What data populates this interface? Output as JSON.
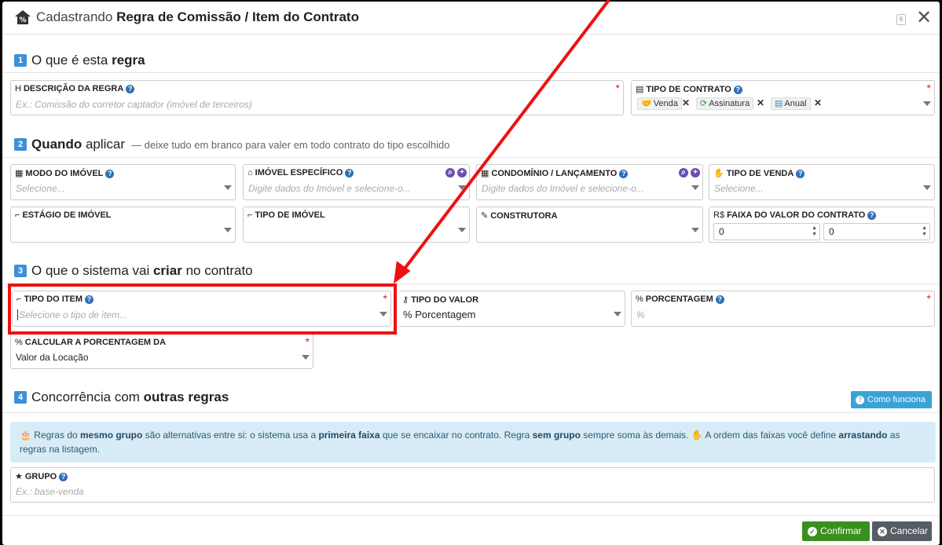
{
  "header": {
    "title_prefix": "Cadastrando",
    "title_bold": "Regra de Comissão / Item do Contrato",
    "shortcut_badge": "6",
    "close_glyph": "✕"
  },
  "sections": {
    "s1": {
      "num": "1",
      "text": "O que é esta ",
      "bold": "regra"
    },
    "s2": {
      "num": "2",
      "bold": "Quando",
      "text": " aplicar",
      "hint": "— deixe tudo em branco para valer em todo contrato do tipo escolhido"
    },
    "s3": {
      "num": "3",
      "text": "O que o sistema vai ",
      "bold": "criar",
      "text2": " no contrato"
    },
    "s4": {
      "num": "4",
      "text": "Concorrência com ",
      "bold": "outras regras"
    }
  },
  "fields": {
    "descricao": {
      "label": "DESCRIÇÃO DA REGRA",
      "icon": "H",
      "placeholder": "Ex.: Comissão do corretor captador (imóvel de terceiros)",
      "required": "*"
    },
    "tipo_contrato": {
      "label": "TIPO DE CONTRATO",
      "icon": "▤",
      "required": "*",
      "tags": [
        "Venda",
        "Assinatura",
        "Anual"
      ]
    },
    "modo_imovel": {
      "label": "MODO DO IMÓVEL",
      "icon": "▦",
      "placeholder": "Selecione..."
    },
    "imovel_especifico": {
      "label": "IMÓVEL ESPECÍFICO",
      "icon": "⌂",
      "placeholder": "Digite dados do Imóvel e selecione-o..."
    },
    "condominio": {
      "label": "CONDOMÍNIO / LANÇAMENTO",
      "icon": "▦",
      "placeholder": "Digite dados do Imóvel e selecione-o..."
    },
    "tipo_venda": {
      "label": "TIPO DE VENDA",
      "icon": "✋",
      "placeholder": "Selecione..."
    },
    "estagio": {
      "label": "ESTÁGIO DE IMÓVEL",
      "icon": "⌐"
    },
    "tipo_imovel": {
      "label": "TIPO DE IMÓVEL",
      "icon": "⌐"
    },
    "construtora": {
      "label": "CONSTRUTORA",
      "icon": "✎"
    },
    "faixa_valor": {
      "label": "FAIXA DO VALOR DO CONTRATO",
      "icon": "R$",
      "min": "0",
      "max": "0"
    },
    "tipo_item": {
      "label": "TIPO DO ITEM",
      "icon": "⌐",
      "placeholder": "Selecione o tipo de item...",
      "required": "*"
    },
    "tipo_valor": {
      "label": "TIPO DO VALOR",
      "icon": "⚷",
      "value": "Porcentagem",
      "value_icon": "%"
    },
    "porcentagem": {
      "label": "PORCENTAGEM",
      "icon": "%",
      "placeholder": "%",
      "required": "*"
    },
    "calcular": {
      "label": "CALCULAR A PORCENTAGEM DA",
      "icon": "%",
      "value": "Valor da Locação",
      "required": "*"
    },
    "grupo": {
      "label": "GRUPO",
      "icon": "★",
      "placeholder": "Ex.: base-venda"
    }
  },
  "how_button": "Como funciona",
  "info": {
    "p1": "Regras do ",
    "b1": "mesmo grupo",
    "p2": " são alternativas entre si: o sistema usa a ",
    "b2": "primeira faixa",
    "p3": " que se encaixar no contrato. Regra ",
    "b3": "sem grupo",
    "p4": " sempre soma às demais. ",
    "p5": " A ordem das faixas você define ",
    "b4": "arrastando",
    "p6": " as regras na listagem."
  },
  "buttons": {
    "confirm": "Confirmar",
    "cancel": "Cancelar"
  },
  "colors": {
    "accent": "#3d8fd8",
    "confirm": "#3b8f1e",
    "cancel": "#555c63",
    "annotation": "#ee1111"
  }
}
